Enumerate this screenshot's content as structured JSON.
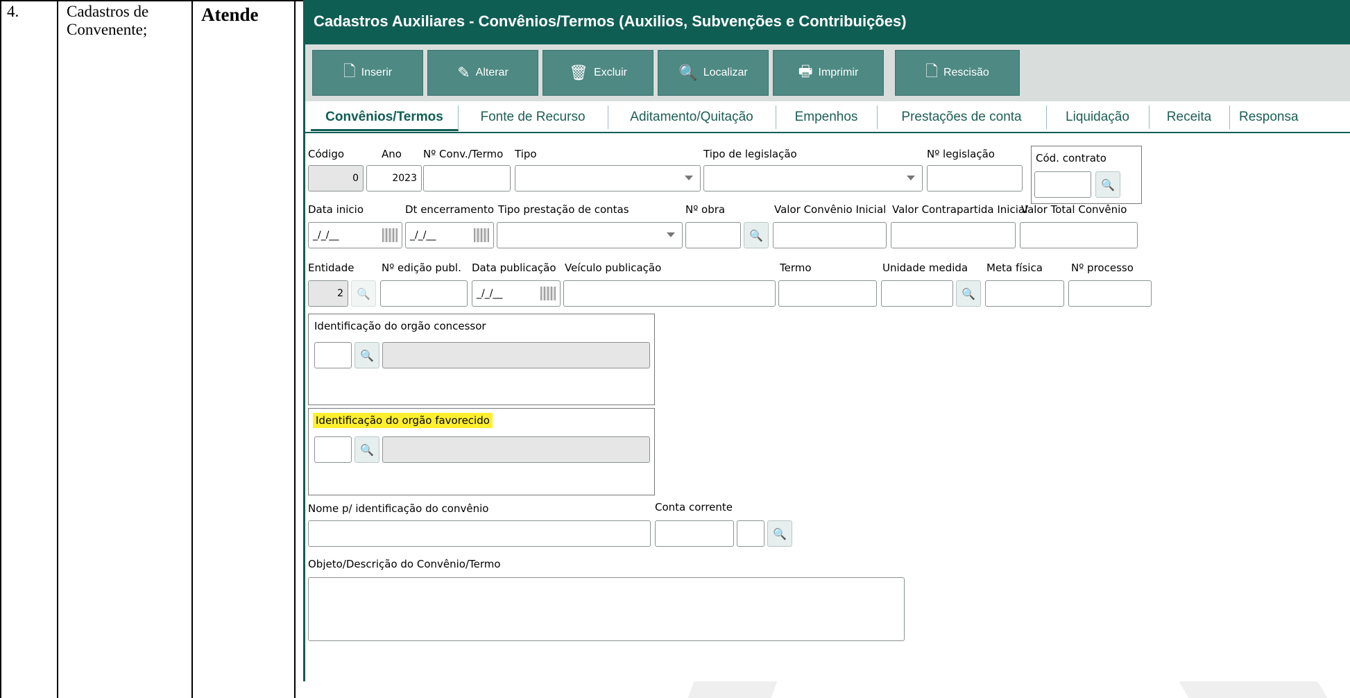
{
  "doc": {
    "row_number": "4.",
    "description": "Cadastros de Convenente;",
    "status": "Atende"
  },
  "window": {
    "title": "Cadastros Auxiliares - Convênios/Termos (Auxilios, Subvenções e Contribuições)",
    "toolbar": [
      {
        "label": "Inserir",
        "icon": "document-add-icon"
      },
      {
        "label": "Alterar",
        "icon": "pencil-icon"
      },
      {
        "label": "Excluir",
        "icon": "trash-icon"
      },
      {
        "label": "Localizar",
        "icon": "search-icon"
      },
      {
        "label": "Imprimir",
        "icon": "printer-icon"
      },
      {
        "label": "Rescisão",
        "icon": "document-remove-icon"
      }
    ],
    "tabs": [
      {
        "label": "Convênios/Termos",
        "active": true
      },
      {
        "label": "Fonte de Recurso"
      },
      {
        "label": "Aditamento/Quitação"
      },
      {
        "label": "Empenhos"
      },
      {
        "label": "Prestações de conta"
      },
      {
        "label": "Liquidação"
      },
      {
        "label": "Receita"
      },
      {
        "label": "Responsa"
      }
    ]
  },
  "form": {
    "codigo": {
      "label": "Código",
      "value": "0"
    },
    "ano": {
      "label": "Ano",
      "value": "2023"
    },
    "num_conv": {
      "label": "Nº Conv./Termo",
      "value": ""
    },
    "tipo": {
      "label": "Tipo",
      "value": ""
    },
    "tipo_legislacao": {
      "label": "Tipo de legislação",
      "value": ""
    },
    "num_legislacao": {
      "label": "Nº legislação",
      "value": ""
    },
    "cod_contrato": {
      "label": "Cód. contrato",
      "value": ""
    },
    "data_inicio": {
      "label": "Data inicio",
      "value": "_/_/__"
    },
    "dt_encerramento": {
      "label": "Dt encerramento",
      "value": "_/_/__"
    },
    "tipo_prestacao": {
      "label": "Tipo prestação de contas",
      "value": ""
    },
    "num_obra": {
      "label": "Nº obra",
      "value": ""
    },
    "valor_conv_inicial": {
      "label": "Valor Convênio Inicial",
      "value": ""
    },
    "valor_contrapartida": {
      "label": "Valor Contrapartida Inicial",
      "value": ""
    },
    "valor_total": {
      "label": "Valor Total Convênio",
      "value": ""
    },
    "entidade": {
      "label": "Entidade",
      "value": "2"
    },
    "num_edicao": {
      "label": "Nº edição publ.",
      "value": ""
    },
    "data_publicacao": {
      "label": "Data publicação",
      "value": "_/_/__"
    },
    "veiculo_publicacao": {
      "label": "Veículo publicação",
      "value": ""
    },
    "termo": {
      "label": "Termo",
      "value": ""
    },
    "unidade_medida": {
      "label": "Unidade medida",
      "value": ""
    },
    "meta_fisica": {
      "label": "Meta física",
      "value": ""
    },
    "num_processo": {
      "label": "Nº processo",
      "value": ""
    },
    "orgao_concessor": {
      "label": "Identificação do orgão concessor"
    },
    "orgao_favorecido": {
      "label": "Identificação do orgão favorecido",
      "highlight_color": "#ffef2e"
    },
    "nome_identificacao": {
      "label": "Nome p/ identificação do convênio",
      "value": ""
    },
    "conta_corrente": {
      "label": "Conta corrente",
      "value": ""
    },
    "objeto_descricao": {
      "label": "Objeto/Descrição do Convênio/Termo",
      "value": ""
    }
  },
  "colors": {
    "title_bar": "#0f5e54",
    "button": "#4e8983",
    "toolbar_bg": "#d9dedd",
    "highlight": "#ffef2e"
  }
}
